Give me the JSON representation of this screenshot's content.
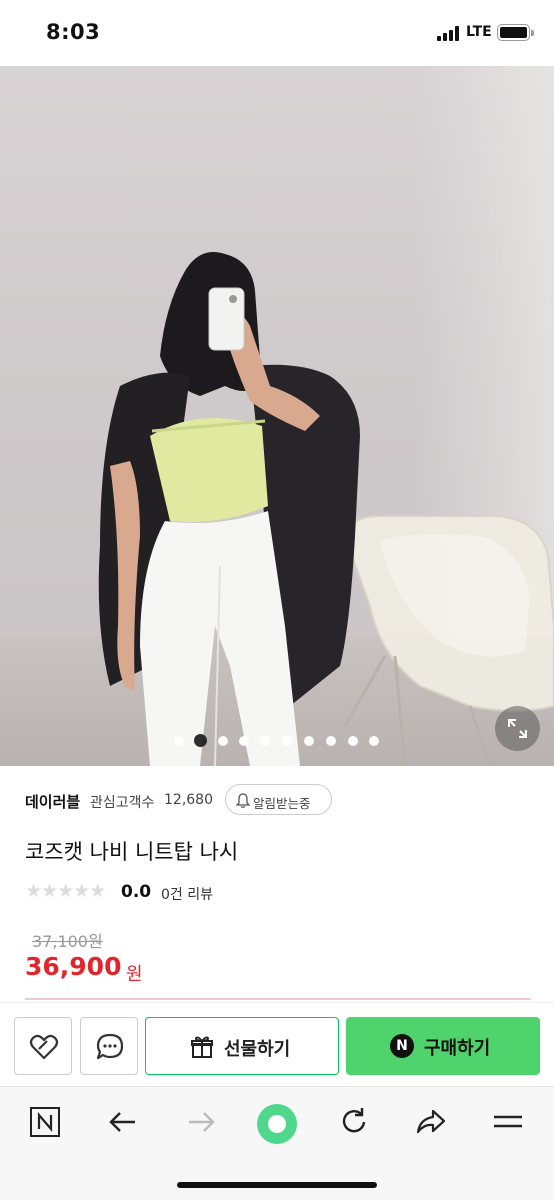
{
  "status_bar": {
    "time": "8:03",
    "network": "LTE"
  },
  "gallery": {
    "slide_count": 10,
    "active_index": 1,
    "expand_icon": "expand-arrows-icon"
  },
  "store": {
    "name": "데이러블",
    "interest_label": "관심고객수",
    "interest_count": "12,680",
    "notify_label": "알림받는중",
    "notify_icon": "bell-icon"
  },
  "product": {
    "title": "코즈캣 나비 니트탑 나시",
    "rating_stars": "★★★★★",
    "rating": "0.0",
    "review_count": "0건 리뷰",
    "original_price": "37,100원",
    "sale_price": "36,900",
    "sale_unit": "원"
  },
  "actions": {
    "wish_icon": "heart-link-icon",
    "chat_icon": "chat-bubble-icon",
    "gift_label": "선물하기",
    "gift_icon": "gift-icon",
    "buy_label": "구매하기",
    "buy_badge": "N"
  },
  "colors": {
    "naver_green": "#03c75a",
    "buy_button": "#4ed36d",
    "price_red": "#e0262d"
  },
  "browser_toolbar": {
    "items": [
      "naver-home-icon",
      "back-arrow-icon",
      "forward-arrow-icon",
      "green-dot-icon",
      "refresh-icon",
      "share-icon",
      "menu-icon"
    ]
  }
}
